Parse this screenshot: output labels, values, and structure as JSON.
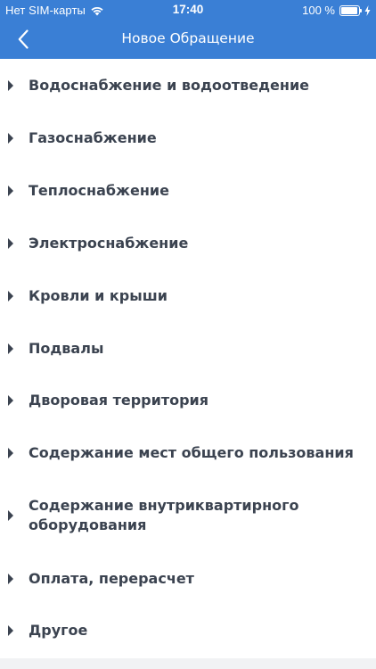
{
  "status_bar": {
    "carrier": "Нет SIM-карты",
    "time": "17:40",
    "battery_percent": "100 %",
    "battery_level": 1.0,
    "icons": [
      "wifi-icon",
      "battery-icon",
      "charging-bolt-icon"
    ]
  },
  "nav": {
    "title": "Новое Обращение",
    "back_icon": "chevron-left-icon"
  },
  "colors": {
    "accent": "#3a7fd5",
    "text": "#3b4350",
    "background": "#ffffff",
    "footer": "#f1f2f4"
  },
  "categories": [
    {
      "label": "Водоснабжение и водоотведение"
    },
    {
      "label": "Газоснабжение"
    },
    {
      "label": "Теплоснабжение"
    },
    {
      "label": "Электроснабжение"
    },
    {
      "label": "Кровли и крыши"
    },
    {
      "label": "Подвалы"
    },
    {
      "label": "Дворовая территория"
    },
    {
      "label": "Содержание мест общего пользования"
    },
    {
      "label": "Содержание внутриквартирного\nоборудования"
    },
    {
      "label": "Оплата, перерасчет"
    },
    {
      "label": "Другое"
    }
  ]
}
